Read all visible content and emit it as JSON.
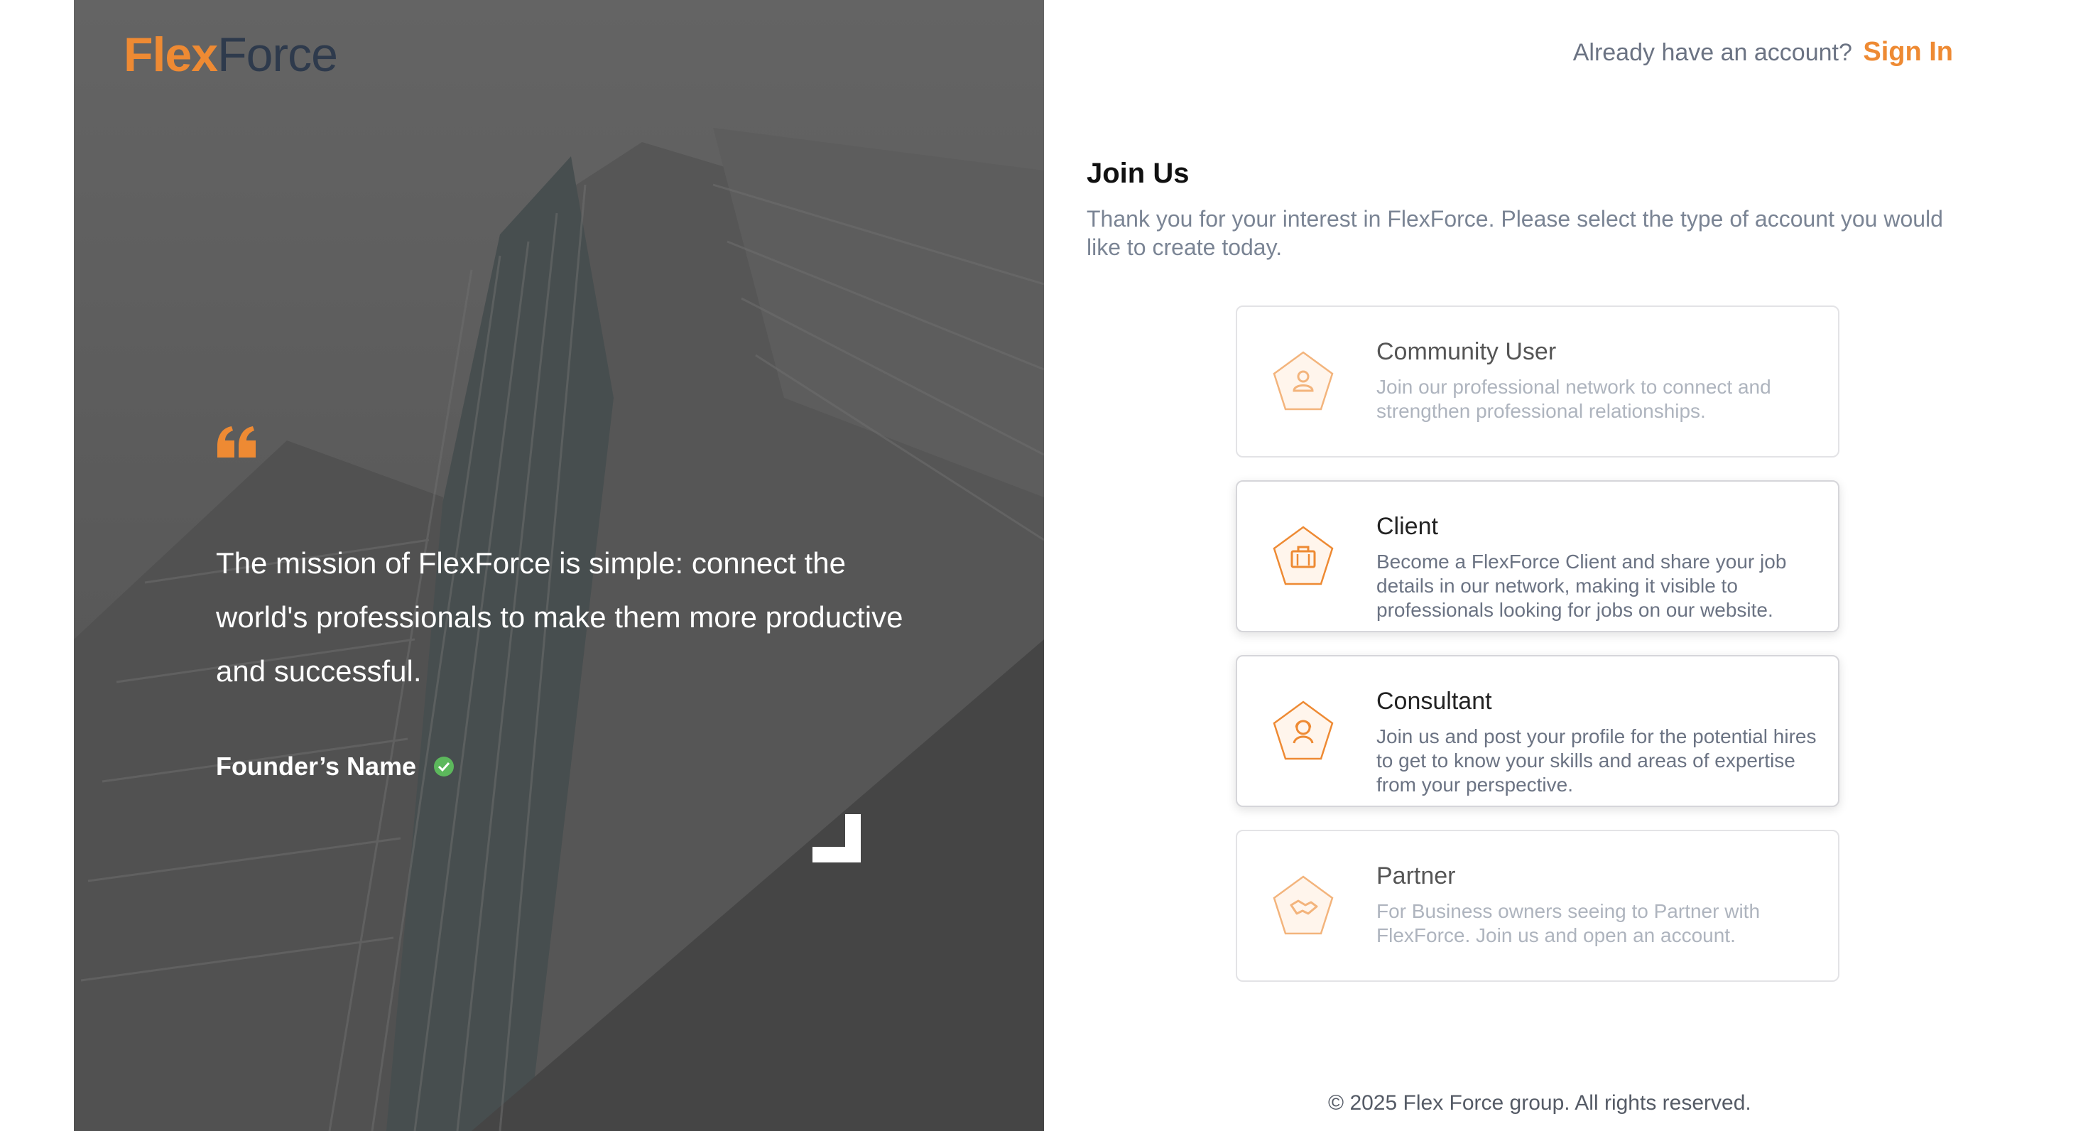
{
  "brand": {
    "logo_text_a": "Flex",
    "logo_text_b": "Force",
    "accent": "#ee8a33",
    "dark": "#2e3a4c"
  },
  "hero": {
    "quote_icon": "quote-icon",
    "mission": "The mission of FlexForce is simple: connect the world's professionals to make them more productive and successful.",
    "founder_name": "Founder’s Name",
    "verified_icon": "check-circle-icon"
  },
  "header": {
    "prompt": "Already have an account?",
    "sign_in": "Sign In"
  },
  "join": {
    "title": "Join Us",
    "subtitle": "Thank you for your interest in FlexForce. Please select the type of account you would like to create today."
  },
  "account_types": [
    {
      "title": "Community User",
      "description": "Join our professional network to connect and strengthen professional relationships.",
      "icon": "user-icon",
      "enabled": false
    },
    {
      "title": "Client",
      "description": "Become a FlexForce Client and share your job details in our network, making it visible to professionals looking for jobs on our website.",
      "icon": "briefcase-icon",
      "enabled": true
    },
    {
      "title": "Consultant",
      "description": "Join us and post your profile for the potential hires to get to know your skills and areas of expertise from your perspective.",
      "icon": "consultant-icon",
      "enabled": true
    },
    {
      "title": "Partner",
      "description": "For Business owners seeing to Partner with FlexForce. Join us and open an account.",
      "icon": "handshake-icon",
      "enabled": false
    }
  ],
  "footer": {
    "copyright": "© 2025 Flex Force group. All rights reserved."
  }
}
